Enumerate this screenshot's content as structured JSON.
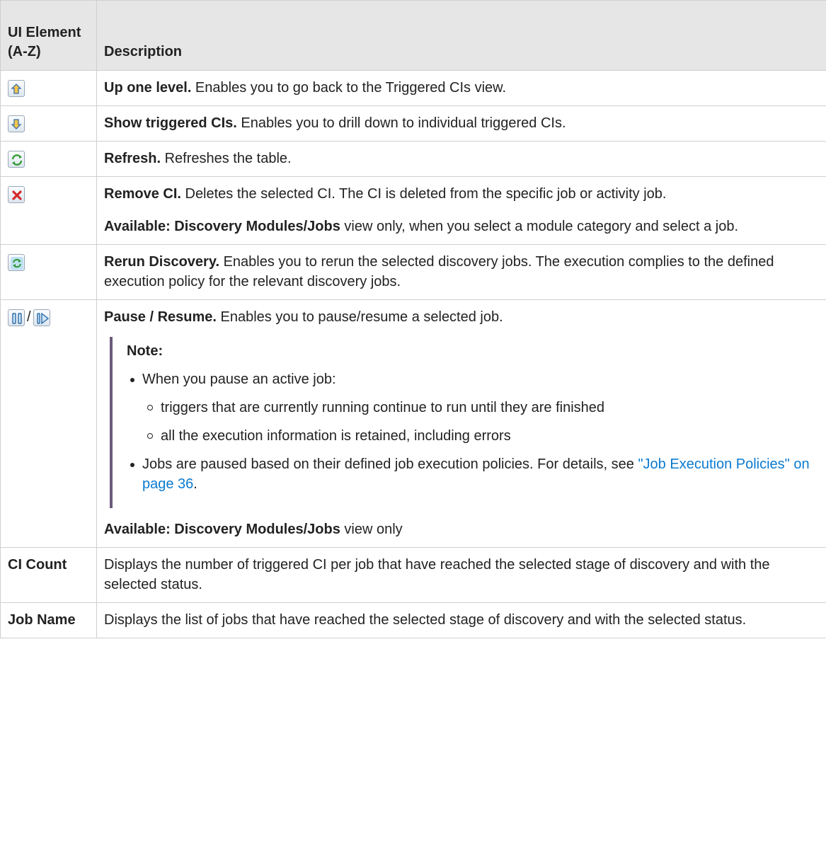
{
  "header": {
    "col1": "UI Element (A-Z)",
    "col2": "Description"
  },
  "rows": [
    {
      "icon": "up-one-level-icon",
      "title": "Up one level.",
      "text": " Enables you to go back to the Triggered CIs view."
    },
    {
      "icon": "show-triggered-cis-icon",
      "title": "Show triggered CIs.",
      "text": " Enables you to drill down to individual triggered CIs."
    },
    {
      "icon": "refresh-icon",
      "title": "Refresh.",
      "text": " Refreshes the table."
    },
    {
      "icon": "remove-ci-icon",
      "title": "Remove CI.",
      "text": " Deletes the selected CI. The CI is deleted from the specific job or activity job.",
      "available_label": "Available: Discovery Modules/Jobs",
      "available_text": " view only, when you select a module category and select a job."
    },
    {
      "icon": "rerun-discovery-icon",
      "title": "Rerun Discovery.",
      "text": " Enables you to rerun the selected discovery jobs. The execution complies to the defined execution policy for the relevant discovery jobs."
    },
    {
      "icon": "pause-icon",
      "icon2": "resume-icon",
      "separator": "/",
      "title": "Pause / Resume.",
      "text": " Enables you to pause/resume a selected job.",
      "note": {
        "title": "Note:",
        "bullet1": "When you pause an active job:",
        "sub1": "triggers that are currently running continue to run until they are finished",
        "sub2": "all the execution information is retained, including errors",
        "bullet2_text": "Jobs are paused based on their defined job execution policies. For details, see ",
        "bullet2_link": "\"Job Execution Policies\" on page 36",
        "bullet2_end": "."
      },
      "available_label": "Available: Discovery Modules/Jobs",
      "available_text": " view only"
    },
    {
      "label": "CI Count",
      "text": "Displays the number of triggered CI per job that have reached the selected stage of discovery and with the selected status."
    },
    {
      "label": "Job Name",
      "text": "Displays the list of jobs that have reached the selected stage of discovery and with the selected status."
    }
  ],
  "colors": {
    "header_bg": "#e6e6e6",
    "border": "#cfcfcf",
    "link": "#0b7ad0",
    "note_bar": "#6b5b7b"
  }
}
